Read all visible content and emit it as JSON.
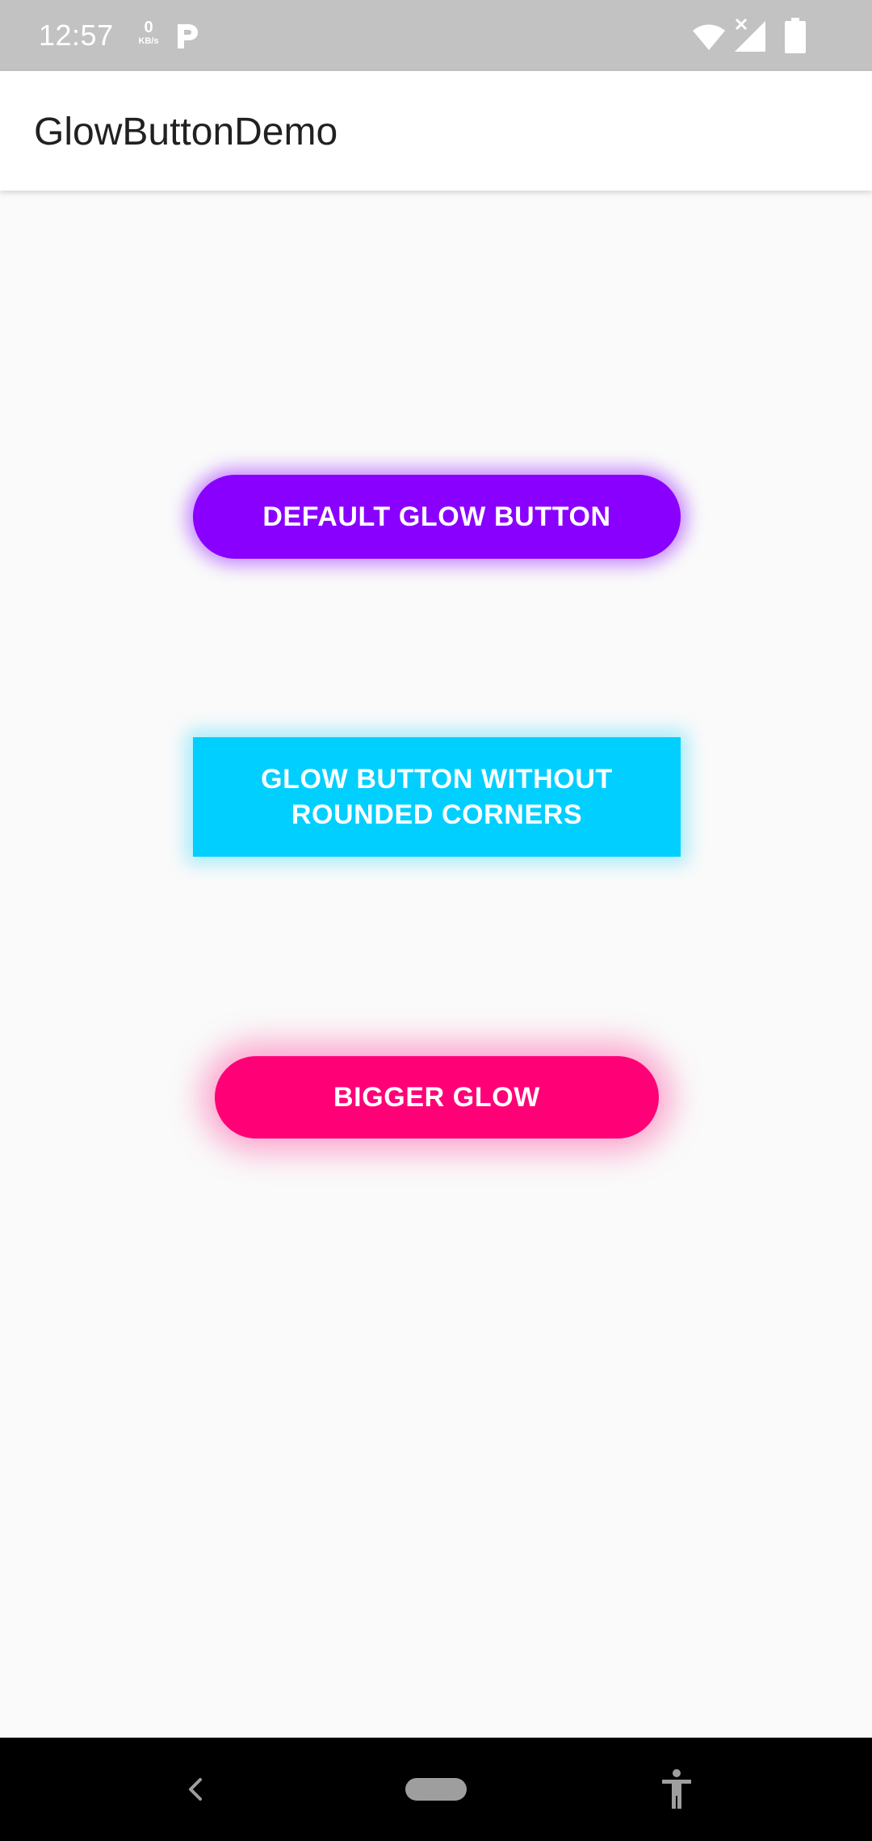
{
  "status_bar": {
    "time": "12:57",
    "net_speed_value": "0",
    "net_speed_unit": "KB/s",
    "icons": [
      "p-notification-icon",
      "wifi-icon",
      "signal-no-data-icon",
      "battery-icon"
    ]
  },
  "app_bar": {
    "title": "GlowButtonDemo"
  },
  "buttons": {
    "default": {
      "label": "DEFAULT GLOW BUTTON",
      "color": "#8a00ff"
    },
    "no_rounded_corners": {
      "label_line1": "GLOW BUTTON WITHOUT",
      "label_line2": "ROUNDED CORNERS",
      "color": "#00cfff"
    },
    "bigger_glow": {
      "label": "BIGGER GLOW",
      "color": "#ff0077"
    }
  },
  "nav_bar": {
    "icons": [
      "back-icon",
      "home-pill-icon",
      "accessibility-icon"
    ]
  }
}
